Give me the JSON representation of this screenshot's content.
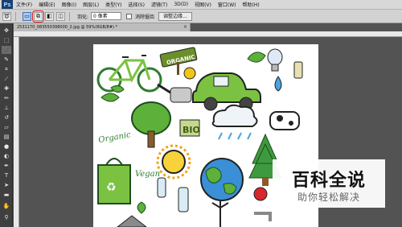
{
  "menubar": {
    "logo": "Ps",
    "items": [
      "文件(F)",
      "编辑(E)",
      "图像(I)",
      "图层(L)",
      "类型(Y)",
      "选择(S)",
      "滤镜(T)",
      "3D(D)",
      "视图(V)",
      "窗口(W)",
      "帮助(H)"
    ]
  },
  "options": {
    "feather_label": "羽化:",
    "feather_value": "0 像素",
    "antialias_label": "消除锯齿",
    "refine_edge_label": "调整边缘..."
  },
  "document": {
    "tab_title": "2531170_083550398000_2.jpg @ 59%(RGB/8#) *",
    "close_glyph": "×"
  },
  "canvas_art": {
    "organic_sign": "ORGANIC",
    "bio_sign": "BIO",
    "organic_script": "Organic",
    "vegan_script": "Vegan",
    "bag_symbol": "♻"
  },
  "watermark": {
    "title": "百科全说",
    "subtitle": "助你轻松解决"
  },
  "colors": {
    "ps_dark": "#535353",
    "menubar": "#d8d8d8",
    "highlight_circle": "#e02020",
    "leaf_green": "#7cc242"
  },
  "icons": {
    "toolbox": [
      "move-icon",
      "marquee-icon",
      "lasso-icon",
      "quick-select-icon",
      "crop-icon",
      "eyedropper-icon",
      "healing-icon",
      "brush-icon",
      "stamp-icon",
      "history-brush-icon",
      "eraser-icon",
      "gradient-icon",
      "blur-icon",
      "dodge-icon",
      "pen-icon",
      "type-icon",
      "path-select-icon",
      "shape-icon",
      "hand-icon",
      "zoom-icon"
    ]
  }
}
